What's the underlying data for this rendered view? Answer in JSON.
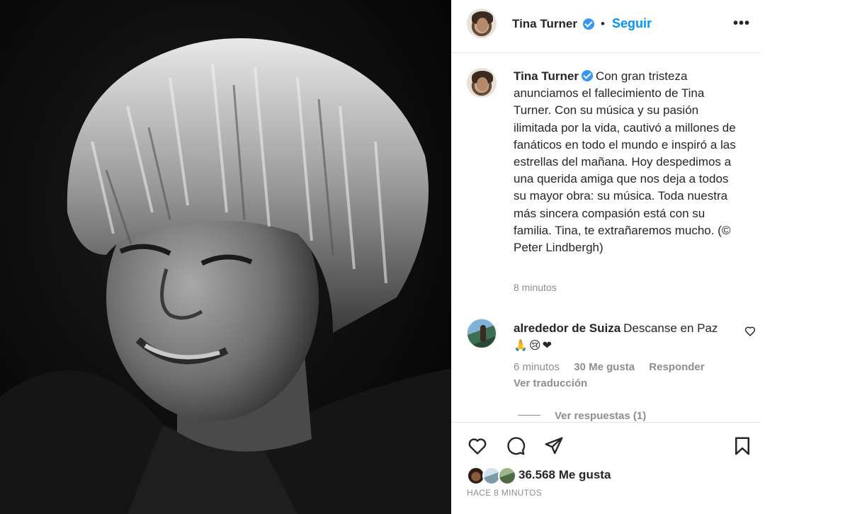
{
  "post": {
    "photo_alt": "Black and white portrait photo",
    "author": "Tina Turner",
    "follow_label": "Seguir",
    "separator": "•",
    "more_label": "•••"
  },
  "caption": {
    "author": "Tina Turner",
    "text": "Con gran tristeza anunciamos el fallecimiento de Tina Turner. Con su música y su pasión ilimitada por la vida, cautivó a millones de fanáticos en todo el mundo e inspiró a las estrellas del mañana. Hoy despedimos a una querida amiga que nos deja a todos su mayor obra: su música. Toda nuestra más sincera compasión está con su familia. Tina, te extrañaremos mucho. (© Peter Lindbergh)",
    "time": "8 minutos"
  },
  "comment": {
    "author": "alrededor de Suiza",
    "text": "Descanse en Paz",
    "emojis": "🙏😢❤",
    "time": "6 minutos",
    "likes": "30 Me gusta",
    "reply_label": "Responder",
    "translate_label": "Ver traducción",
    "replies_label": "Ver respuestas (1)"
  },
  "footer": {
    "likes_count": "36.568 Me gusta",
    "posted": "HACE 8 MINUTOS"
  },
  "icons": {
    "verified": "verified-badge-icon",
    "like": "heart-icon",
    "comment": "comment-icon",
    "share": "share-icon",
    "save": "bookmark-icon"
  },
  "colors": {
    "accent": "#0095f6",
    "verified": "#3897f0",
    "muted": "#8e8e8e",
    "text": "#262626"
  }
}
